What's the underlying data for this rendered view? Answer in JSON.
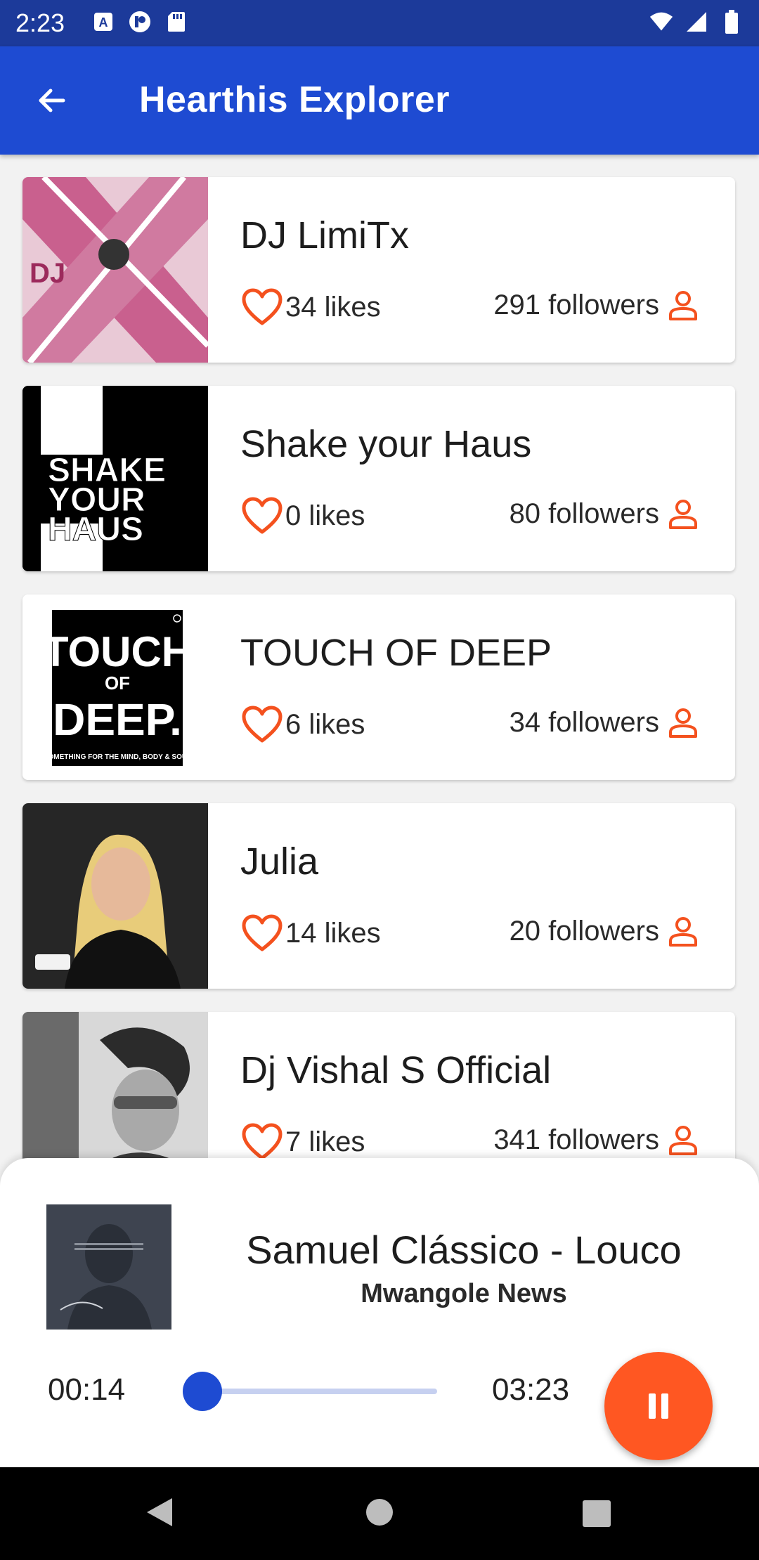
{
  "status_bar": {
    "time": "2:23",
    "left_icons": [
      "a-notification-icon",
      "p-notification-icon",
      "sd-card-icon"
    ],
    "right_icons": [
      "wifi-icon",
      "signal-icon",
      "battery-icon"
    ]
  },
  "app_bar": {
    "title": "Hearthis Explorer",
    "back_icon": "arrow-left-icon",
    "background": "#1e4bd2"
  },
  "artists": [
    {
      "name": "DJ LimiTx",
      "likes": "34 likes",
      "followers": "291 followers"
    },
    {
      "name": "Shake your Haus",
      "likes": "0 likes",
      "followers": "80 followers"
    },
    {
      "name": "TOUCH OF DEEP",
      "likes": "6 likes",
      "followers": "34 followers"
    },
    {
      "name": "Julia",
      "likes": "14 likes",
      "followers": "20 followers"
    },
    {
      "name": "Dj Vishal S Official",
      "likes": "7 likes",
      "followers": "341 followers"
    }
  ],
  "logos": {
    "shake": [
      "SHAKE",
      "YOUR",
      "HAUS"
    ],
    "touch": [
      "TOUCH",
      "OF",
      "DEEP."
    ],
    "touch_tagline": "SOMETHING FOR THE MIND, BODY & SOUL"
  },
  "player": {
    "title": "Samuel Clássico - Louco",
    "artist": "Mwangole News",
    "current_time": "00:14",
    "total_time": "03:23",
    "progress": 0.07,
    "state": "playing",
    "button_icon": "pause-icon"
  },
  "colors": {
    "accent": "#ff5722",
    "primary": "#1e4bd2",
    "status_bar": "#1c3a9a"
  },
  "nav_bar": {
    "icons": [
      "back-triangle-icon",
      "home-circle-icon",
      "recents-square-icon"
    ]
  }
}
